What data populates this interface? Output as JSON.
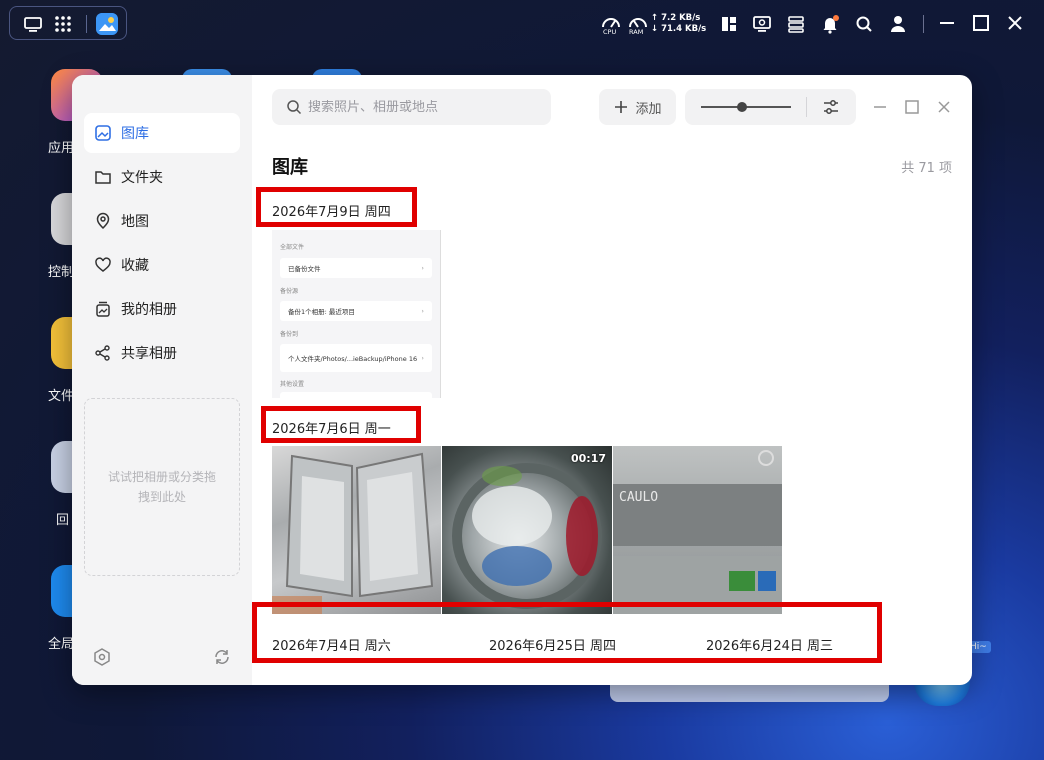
{
  "taskbar": {
    "upload_speed": "↑ 7.2 KB/s",
    "download_speed": "↓ 71.4 KB/s",
    "cpu_label": "CPU",
    "ram_label": "RAM"
  },
  "desktop_icons": [
    {
      "label": "应用"
    },
    {
      "label": "控制"
    },
    {
      "label": "文件"
    },
    {
      "label": "回"
    },
    {
      "label": "全局"
    }
  ],
  "sidebar": {
    "items": [
      {
        "label": "图库",
        "icon": "gallery-icon",
        "active": true
      },
      {
        "label": "文件夹",
        "icon": "folder-icon"
      },
      {
        "label": "地图",
        "icon": "map-pin-icon"
      },
      {
        "label": "收藏",
        "icon": "heart-icon"
      },
      {
        "label": "我的相册",
        "icon": "album-icon"
      },
      {
        "label": "共享相册",
        "icon": "share-icon"
      }
    ],
    "dropzone_text": "试试把相册或分类拖拽到此处"
  },
  "toolbar": {
    "search_placeholder": "搜索照片、相册或地点",
    "add_label": "添加",
    "zoom_level": 0.45
  },
  "main": {
    "title": "图库",
    "count": "共 71 项",
    "sections": [
      {
        "date": "2026年7月9日 周四"
      },
      {
        "date": "2026年7月6日 周一"
      }
    ],
    "bottom_dates": [
      "2026年7月4日 周六",
      "2026年6月25日 周四",
      "2026年6月24日 周三"
    ],
    "video_duration": "00:17"
  },
  "screenshot_thumb": {
    "rows": [
      {
        "section": "全部文件",
        "value": "已备份文件"
      },
      {
        "section": "备份源",
        "value": "备份1个相册: 最近项目"
      },
      {
        "section": "备份到",
        "value": "个人文件夹/Photos/...ieBackup/iPhone 16"
      },
      {
        "section": "其他设置",
        "value": ""
      }
    ]
  },
  "washer_display": "CAULO",
  "assistant_badge": "Hi~",
  "colors": {
    "accent": "#2f6fe4",
    "highlight_box": "#e00000"
  }
}
